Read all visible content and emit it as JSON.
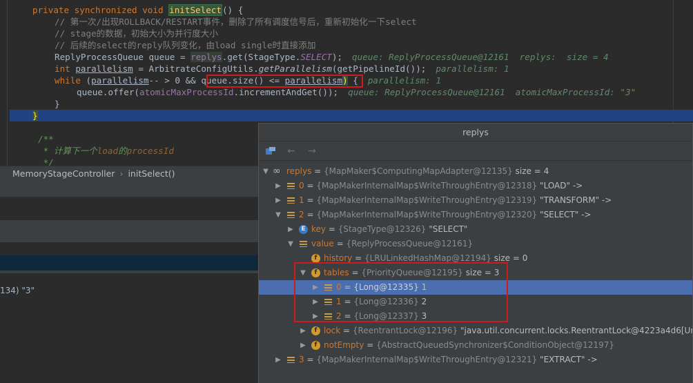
{
  "code": {
    "line0": {
      "kw": "private synchronized void ",
      "fn": "initSelect",
      "rest": "() {"
    },
    "line1": "// 第一次/出现ROLLBACK/RESTART事件，删除了所有调度信号后，重新初始化一下select",
    "line2": "// stage的数据，初始大小为并行度大小",
    "line3": "// 后续的select的reply队列变化，由load single时直接添加",
    "line4": {
      "a": "ReplyProcessQueue queue = ",
      "b": "replys",
      "c": ".get(StageType.",
      "d": "SELECT",
      "e": ");",
      "hint": "queue: ReplyProcessQueue@12161  replys:  size = 4"
    },
    "line5": {
      "a": "int ",
      "b": "parallelism",
      "c": " = ArbitrateConfigUtils.",
      "d": "getParallelism",
      "e": "(getPipelineId());",
      "hint": "parallelism: 1"
    },
    "line6": {
      "a": "while ",
      "b": "(",
      "c": "parallelism",
      "d": "-- > 0 && ",
      "e": "queue.size() <= ",
      "f": "parallelism",
      "g": ")",
      "h": " {",
      "hint": "parallelism: 1"
    },
    "line7": {
      "a": "queue.offer(",
      "b": "atomicMaxProcessId",
      "c": ".incrementAndGet());",
      "hint1": "queue: ReplyProcessQueue@12161  atomicMaxProcessId: ",
      "hint2": "\"3\""
    },
    "line8": "}",
    "line9": "}",
    "line10": "/**",
    "line11": {
      "a": " * 计算下一个",
      "b": "load",
      "c": "的",
      "d": "processId"
    },
    "line12": " */"
  },
  "breadcrumb": {
    "class_name": "MemoryStageController",
    "method_name": "initSelect()"
  },
  "left_pane": {
    "fragment": "134) \"3\""
  },
  "popup": {
    "title": "replys",
    "nodes": [
      {
        "key": "replys",
        "type": "{MapMaker$ComputingMapAdapter@12135}",
        "value": " size = 4"
      },
      {
        "key": "0",
        "type": "{MapMakerInternalMap$WriteThroughEntry@12318}",
        "value": " \"LOAD\" ->"
      },
      {
        "key": "1",
        "type": "{MapMakerInternalMap$WriteThroughEntry@12319}",
        "value": " \"TRANSFORM\" ->"
      },
      {
        "key": "2",
        "type": "{MapMakerInternalMap$WriteThroughEntry@12320}",
        "value": " \"SELECT\" ->"
      },
      {
        "key": "key",
        "type": "{StageType@12326}",
        "value": " \"SELECT\""
      },
      {
        "key": "value",
        "type": "{ReplyProcessQueue@12161}",
        "value": ""
      },
      {
        "key": "history",
        "type": "{LRULinkedHashMap@12194}",
        "value": "  size = 0"
      },
      {
        "key": "tables",
        "type": "{PriorityQueue@12195}",
        "value": "  size = 3"
      },
      {
        "key": "0",
        "type": "{Long@12335}",
        "value": " 1"
      },
      {
        "key": "1",
        "type": "{Long@12336}",
        "value": " 2"
      },
      {
        "key": "2",
        "type": "{Long@12337}",
        "value": " 3"
      },
      {
        "key": "lock",
        "type": "{ReentrantLock@12196}",
        "value": " \"java.util.concurrent.locks.ReentrantLock@4223a4d6[Unlocke"
      },
      {
        "key": "notEmpty",
        "type": "{AbstractQueuedSynchronizer$ConditionObject@12197}",
        "value": ""
      },
      {
        "key": "3",
        "type": "{MapMakerInternalMap$WriteThroughEntry@12321}",
        "value": " \"EXTRACT\" ->"
      }
    ]
  },
  "colors": {
    "keyword": "#cc7832",
    "method": "#ffc66d",
    "field": "#9876aa",
    "comment": "#808080",
    "selection": "#4b6eaf",
    "highlight_box": "#d4191c"
  }
}
